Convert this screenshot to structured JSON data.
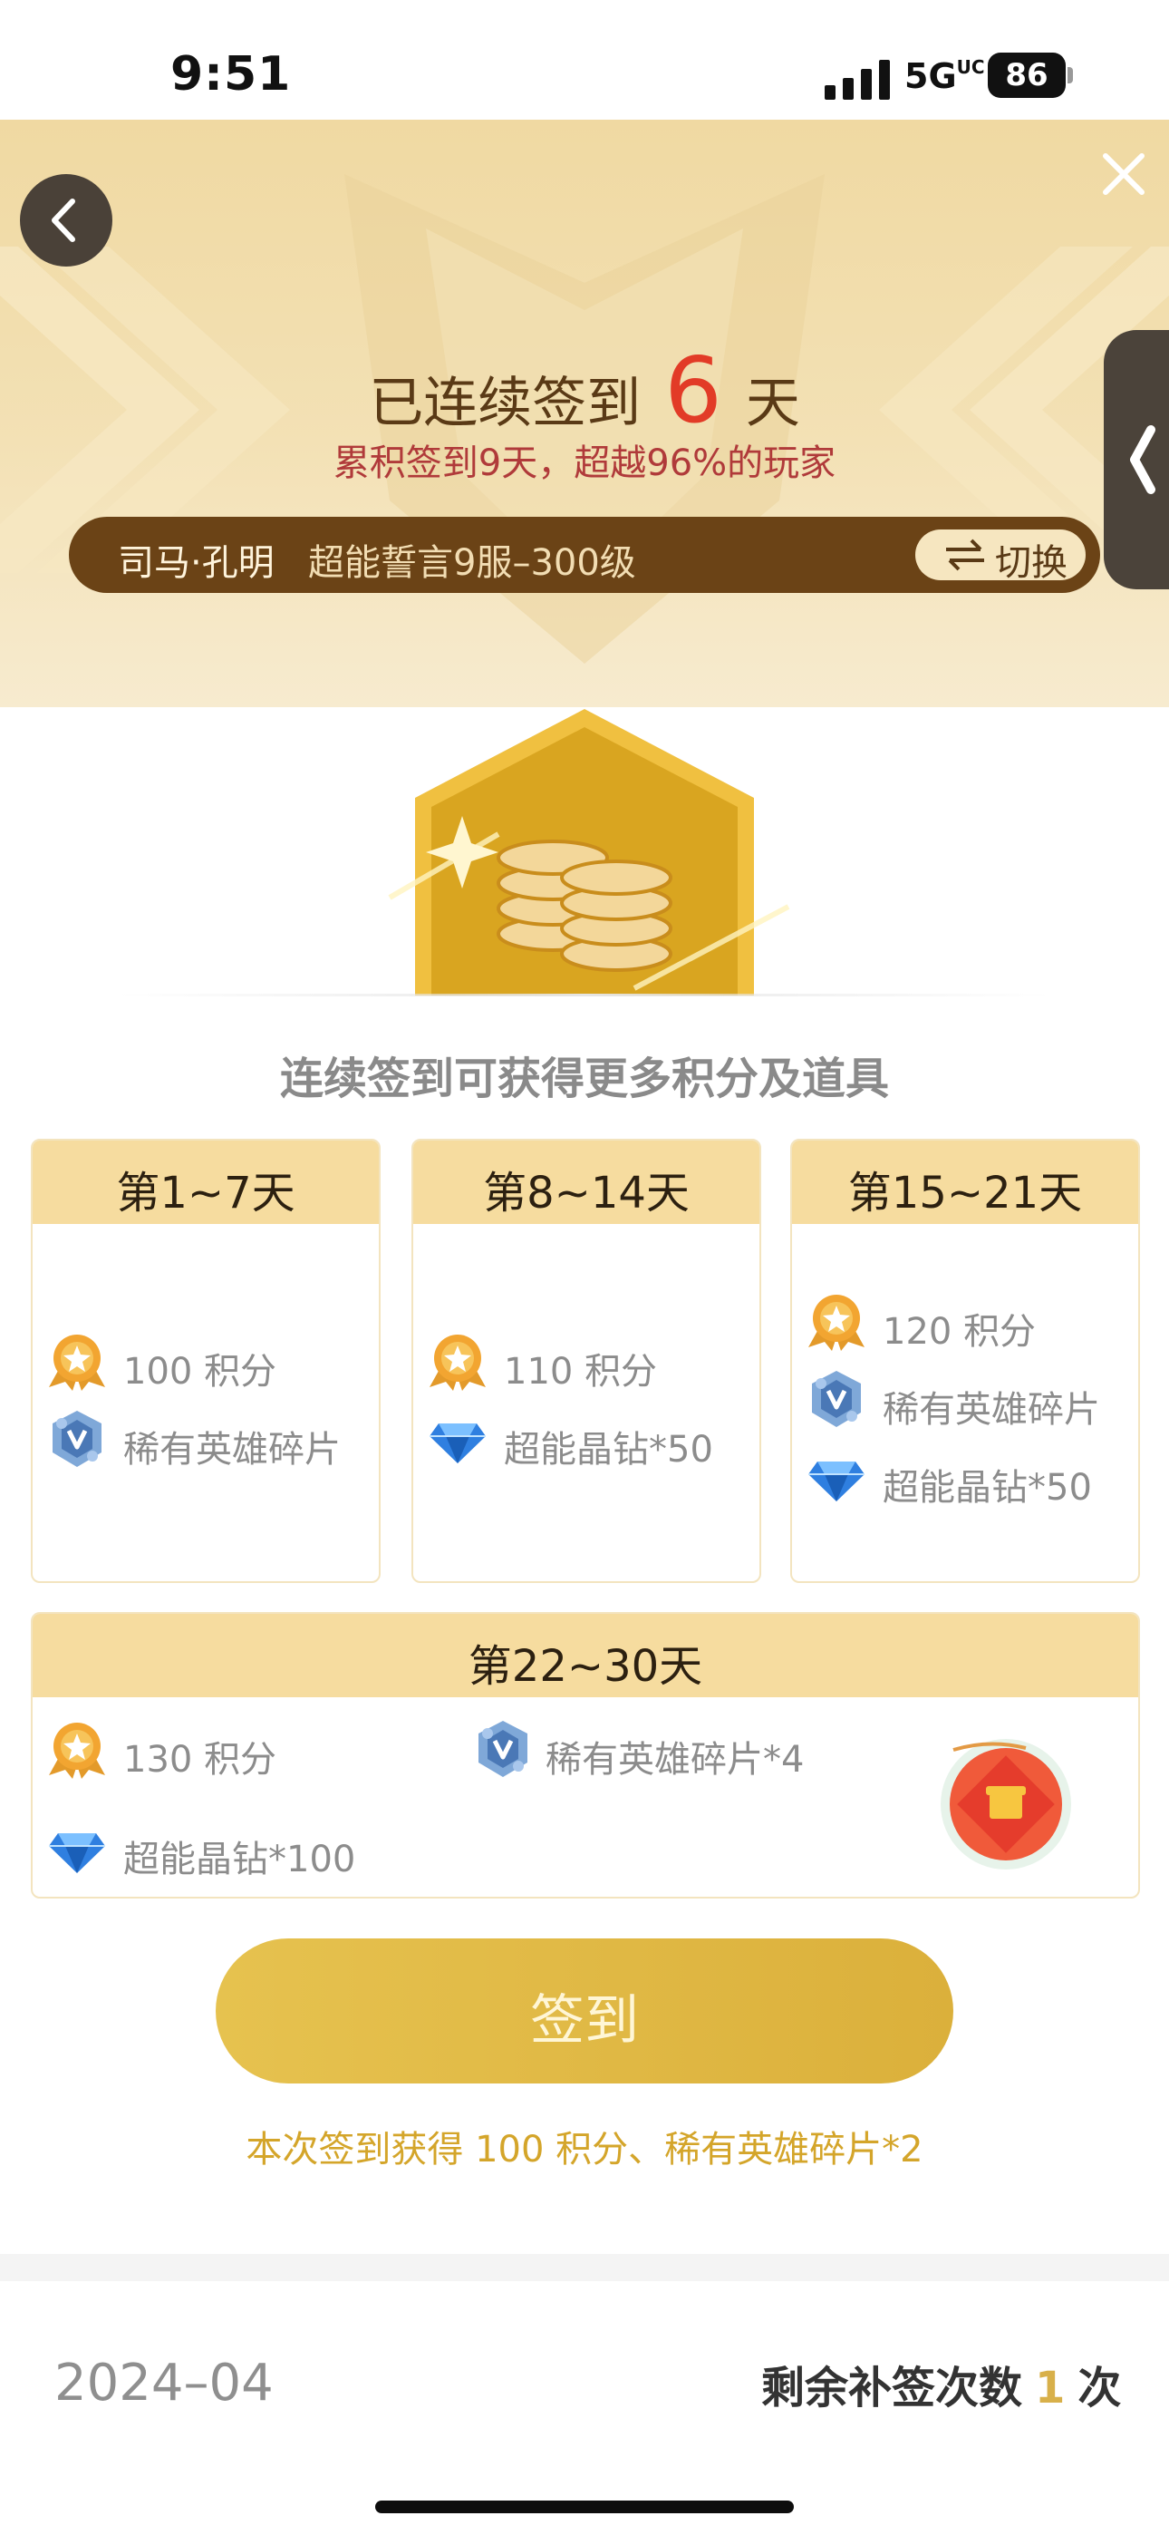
{
  "status_bar": {
    "time": "9:51",
    "network": "5G",
    "network_tag": "UC",
    "battery": "86"
  },
  "header": {
    "title_prefix": "已连续签到",
    "streak_days": "6",
    "title_suffix": "天",
    "subtitle": "累积签到9天，超越96%的玩家",
    "account_name": "司马·孔明",
    "account_server": "超能誓言9服–300级",
    "switch_label": "切换"
  },
  "info_heading": "连续签到可获得更多积分及道具",
  "cards": [
    {
      "title": "第1~7天",
      "rewards": [
        {
          "icon": "points-medal-icon",
          "text": "100 积分"
        },
        {
          "icon": "hero-shard-icon",
          "text": "稀有英雄碎片"
        }
      ]
    },
    {
      "title": "第8~14天",
      "rewards": [
        {
          "icon": "points-medal-icon",
          "text": "110 积分"
        },
        {
          "icon": "diamond-icon",
          "text": "超能晶钻*50"
        }
      ]
    },
    {
      "title": "第15~21天",
      "rewards": [
        {
          "icon": "points-medal-icon",
          "text": "120 积分"
        },
        {
          "icon": "hero-shard-icon",
          "text": "稀有英雄碎片"
        },
        {
          "icon": "diamond-icon",
          "text": "超能晶钻*50"
        }
      ]
    },
    {
      "title": "第22~30天",
      "rewards": [
        {
          "icon": "points-medal-icon",
          "text": "130 积分"
        },
        {
          "icon": "hero-shard-icon",
          "text": "稀有英雄碎片*4"
        },
        {
          "icon": "diamond-icon",
          "text": "超能晶钻*100"
        }
      ]
    }
  ],
  "sign_button_label": "签到",
  "reward_note": "本次签到获得 100 积分、稀有英雄碎片*2",
  "calendar": {
    "month": "2024–04",
    "makeup_prefix": "剩余补签次数",
    "makeup_count": "1",
    "makeup_suffix": "次"
  },
  "colors": {
    "accent_gold": "#dbb03b",
    "streak_red": "#e23b27",
    "header_bg": "#f0d9a2",
    "card_head": "#f6dc9f"
  }
}
